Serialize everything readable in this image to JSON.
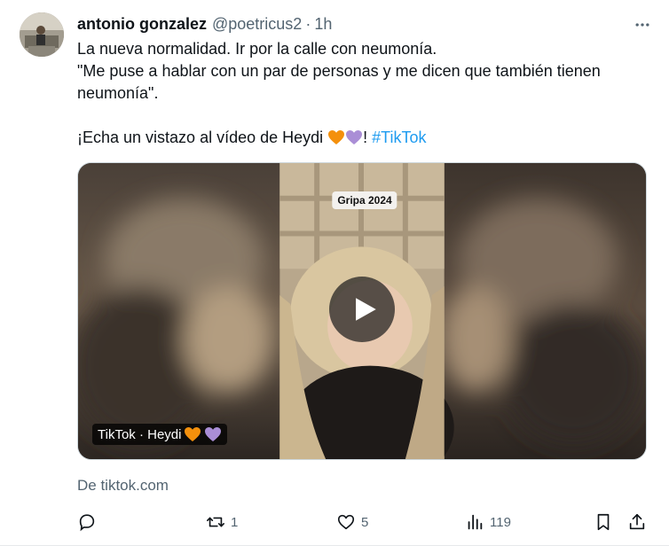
{
  "tweet": {
    "author_name": "antonio gonzalez",
    "author_handle": "@poetricus2",
    "separator": "·",
    "time": "1h",
    "lines": [
      "La nueva normalidad. Ir por la calle con neumonía.",
      "\"Me puse a hablar con un par de personas y me dicen que también tienen",
      "neumonía\"."
    ],
    "share_text_prefix": "¡Echa un vistazo al vídeo de Heydi ",
    "share_text_suffix": "! ",
    "hashtag": "#TikTok",
    "hearts": [
      "orange-heart",
      "purple-heart"
    ]
  },
  "media": {
    "overlay_tag": "Gripa 2024",
    "caption": "TikTok · Heydi ",
    "play_icon": "play-icon"
  },
  "source": "De tiktok.com",
  "actions": {
    "reply": {
      "icon": "reply-icon",
      "count": ""
    },
    "retweet": {
      "icon": "retweet-icon",
      "count": "1"
    },
    "like": {
      "icon": "heart-icon",
      "count": "5"
    },
    "views": {
      "icon": "views-icon",
      "count": "119"
    },
    "bookmark": {
      "icon": "bookmark-icon",
      "count": ""
    },
    "share": {
      "icon": "share-icon",
      "count": ""
    }
  },
  "colors": {
    "text": "#0f1419",
    "secondary": "#536471",
    "link": "#1d9bf0",
    "orange_heart": "#f4900c",
    "purple_heart": "#aa8ed6"
  }
}
